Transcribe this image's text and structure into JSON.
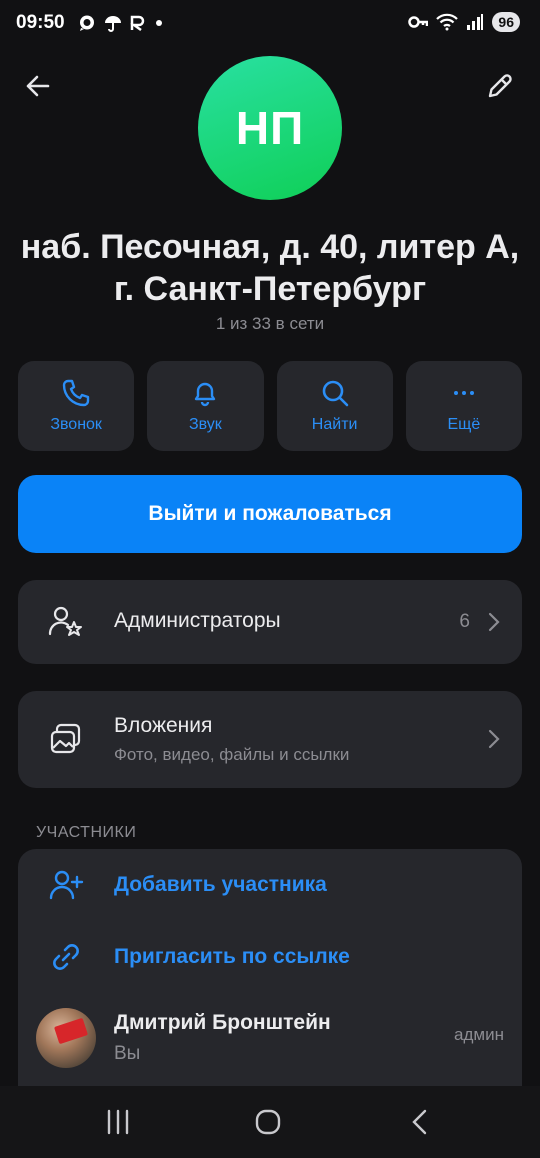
{
  "status_bar": {
    "time": "09:50",
    "left_icons": [
      "chat-bubble-icon",
      "umbrella-icon",
      "r-icon",
      "dot-icon"
    ],
    "right_icons": [
      "key-icon",
      "wifi-icon",
      "signal-icon"
    ],
    "battery": "96"
  },
  "header": {
    "back_icon": "arrow-left-icon",
    "edit_icon": "pencil-icon",
    "avatar_initials": "НП",
    "title": "наб. Песочная, д. 40, литер А, г. Санкт-Петербург",
    "subtitle": "1 из 33 в сети"
  },
  "actions": [
    {
      "label": "Звонок",
      "icon": "phone-icon"
    },
    {
      "label": "Звук",
      "icon": "bell-icon"
    },
    {
      "label": "Найти",
      "icon": "search-icon"
    },
    {
      "label": "Ещё",
      "icon": "more-icon"
    }
  ],
  "leave_button": "Выйти и пожаловаться",
  "admins": {
    "label": "Администраторы",
    "count": "6",
    "icon": "admins-icon"
  },
  "attachments": {
    "label": "Вложения",
    "sublabel": "Фото, видео, файлы и ссылки",
    "icon": "gallery-icon"
  },
  "members_section": {
    "title": "УЧАСТНИКИ",
    "add_member": "Добавить участника",
    "invite_link": "Пригласить по ссылке",
    "members": [
      {
        "name": "Дмитрий Бронштейн",
        "subtitle": "Вы",
        "role": "админ"
      }
    ]
  },
  "colors": {
    "accent": "#0a83f7",
    "link": "#2b8ef6",
    "background": "#111113",
    "card": "#26272c"
  }
}
